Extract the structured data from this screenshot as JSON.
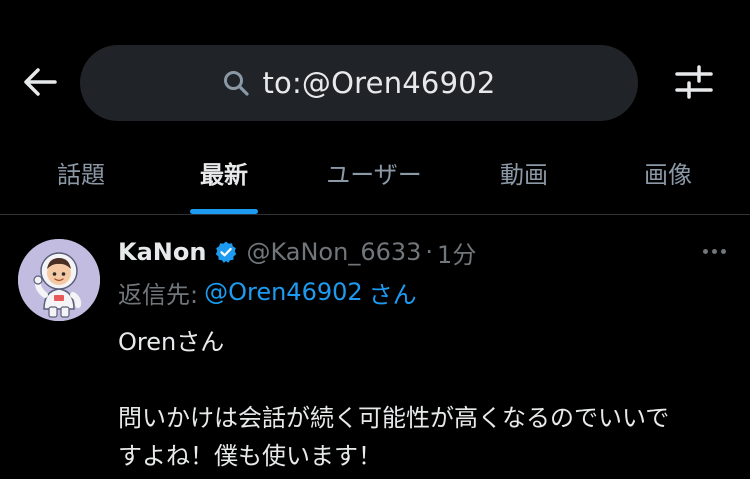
{
  "search": {
    "query": "to:@Oren46902"
  },
  "tabs": [
    {
      "label": "話題",
      "active": false
    },
    {
      "label": "最新",
      "active": true
    },
    {
      "label": "ユーザー",
      "active": false
    },
    {
      "label": "動画",
      "active": false
    },
    {
      "label": "画像",
      "active": false
    }
  ],
  "tweet": {
    "display_name": "KaNon",
    "handle": "@KaNon_6633",
    "separator": "·",
    "time": "1分",
    "reply_label": "返信先:",
    "reply_target": "@Oren46902",
    "reply_suffix": "さん",
    "body": {
      "line1": "Orenさん",
      "line2": "問いかけは会話が続く可能性が高くなるのでいいで",
      "line3": "すよね！僕も使います！"
    }
  },
  "icons": {
    "back": "back-arrow-icon",
    "search": "search-icon",
    "filter": "filter-sliders-icon",
    "verified": "verified-badge-icon",
    "more": "more-dots-icon",
    "avatar": "astronaut-avatar"
  },
  "colors": {
    "background": "#000000",
    "accent": "#1d9bf0",
    "muted": "#71767b",
    "search_bg": "#202327",
    "avatar_bg": "#c2bde0"
  }
}
